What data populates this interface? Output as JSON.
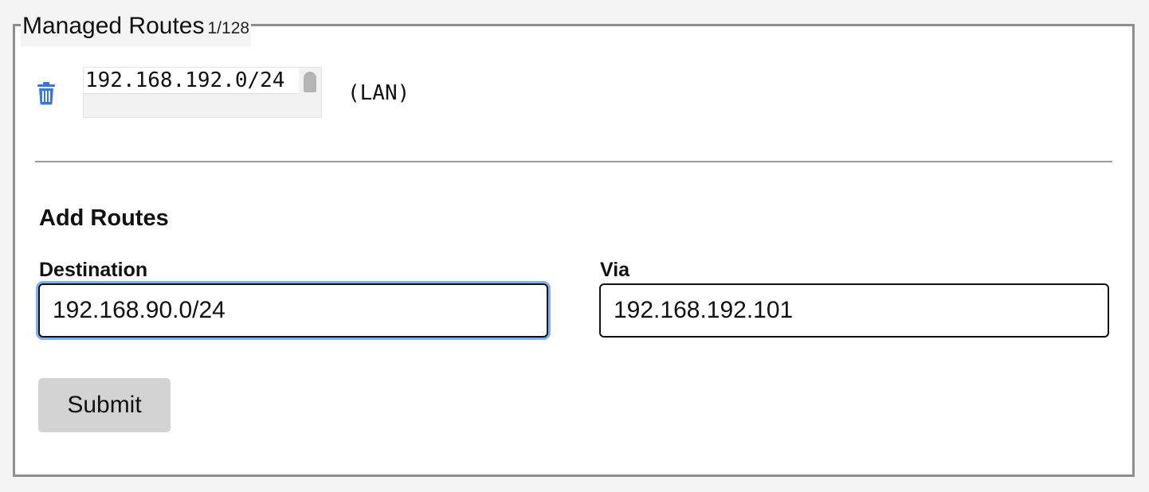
{
  "managed_routes": {
    "title": "Managed Routes",
    "count": "1/128",
    "routes": [
      {
        "destination": "192.168.192.0/24",
        "tag": "(LAN)"
      }
    ]
  },
  "add_routes": {
    "title": "Add Routes",
    "destination": {
      "label": "Destination",
      "value": "192.168.90.0/24"
    },
    "via": {
      "label": "Via",
      "value": "192.168.192.101"
    },
    "submit_label": "Submit"
  },
  "colors": {
    "accent": "#80aef2",
    "trash_icon": "#3a78d8",
    "button_bg": "#d3d3d3"
  },
  "icons": {
    "delete": "trash-icon"
  }
}
